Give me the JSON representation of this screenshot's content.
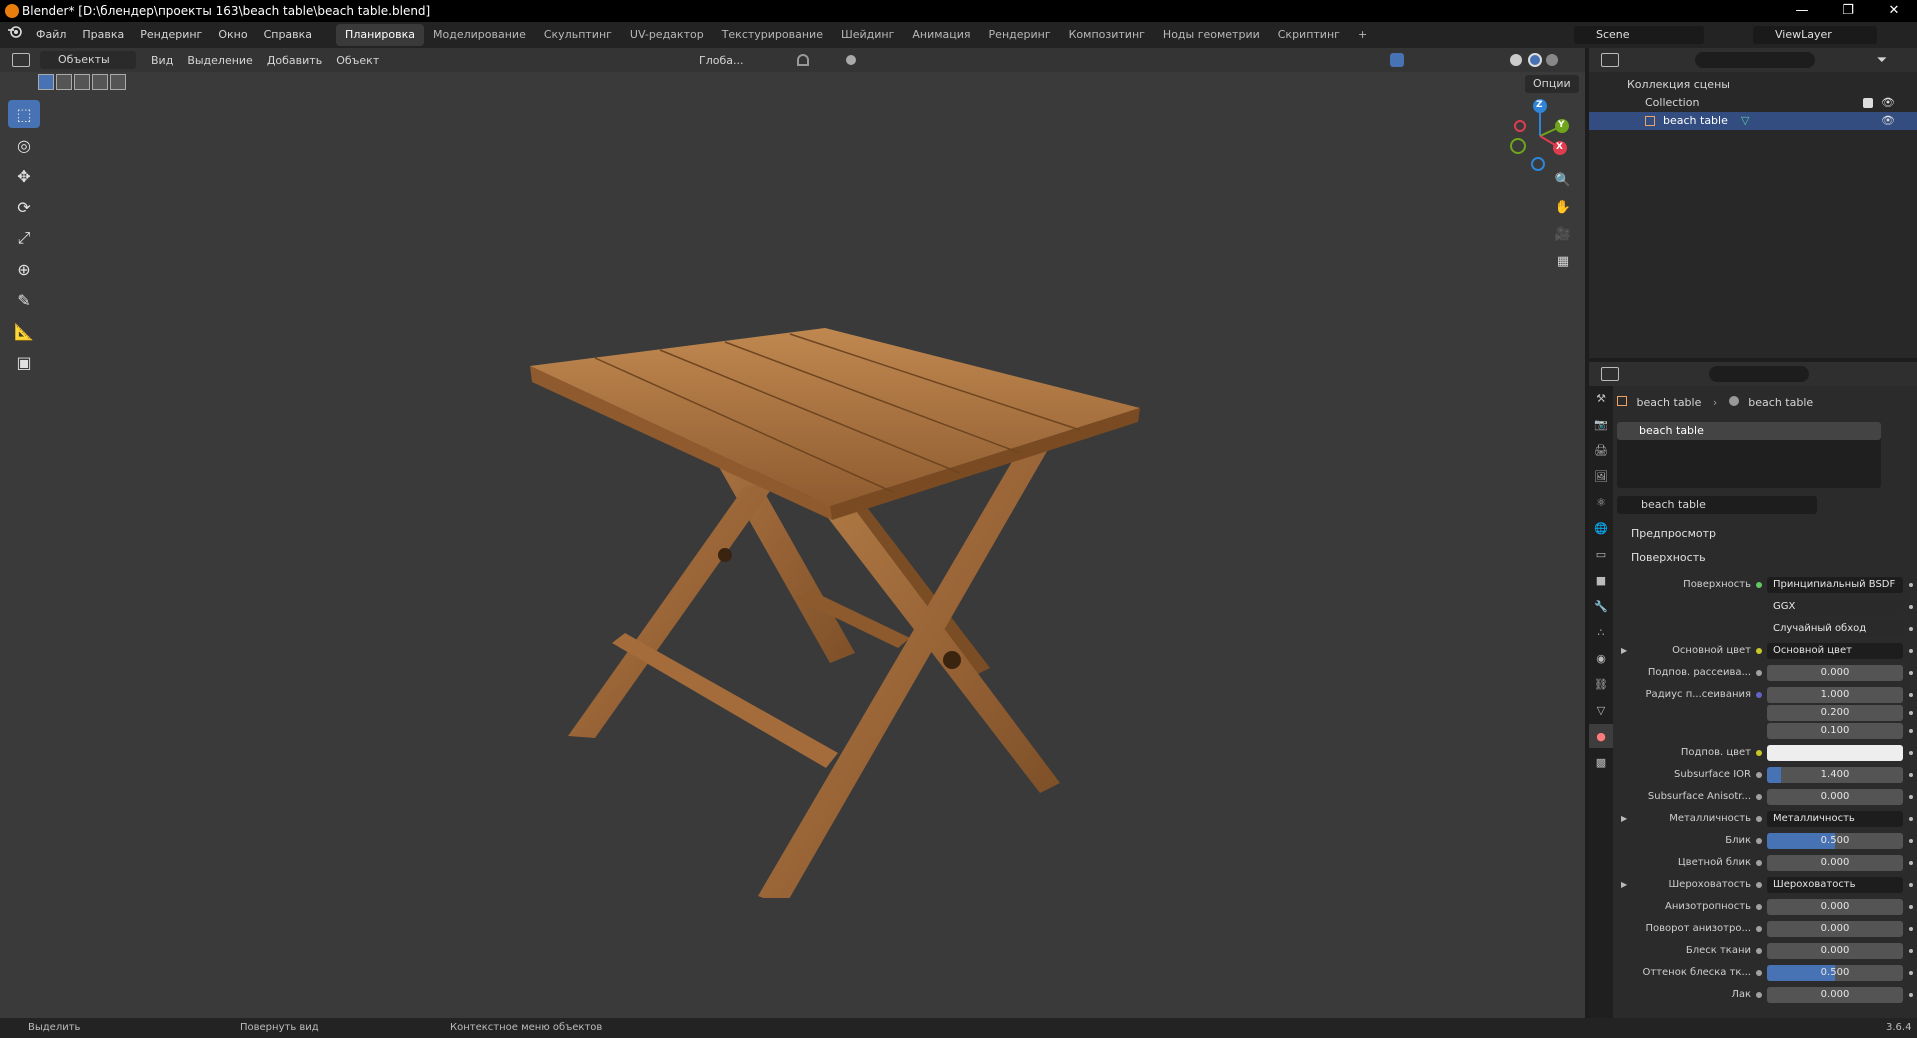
{
  "window": {
    "title": "Blender* [D:\\блендер\\проекты 163\\beach table\\beach table.blend]",
    "controls": [
      "—",
      "❐",
      "✕"
    ]
  },
  "menubar": {
    "items": [
      "Файл",
      "Правка",
      "Рендеринг",
      "Окно",
      "Справка"
    ],
    "workspaces": [
      "Планировка",
      "Моделирование",
      "Скульптинг",
      "UV-редактор",
      "Текстурирование",
      "Шейдинг",
      "Анимация",
      "Рендеринг",
      "Композитинг",
      "Ноды геометрии",
      "Скриптинг"
    ],
    "active_workspace": "Планировка",
    "add_tab": "+",
    "scene": "Scene",
    "view_layer": "ViewLayer"
  },
  "viewport": {
    "mode": "Объекты",
    "menus": [
      "Вид",
      "Выделение",
      "Добавить",
      "Объект"
    ],
    "orientation": "Глоба...",
    "options_label": "Опции",
    "gizmo_labels": {
      "z": "Z",
      "y": "Y",
      "x": "X"
    },
    "tools": [
      "select-box",
      "cursor",
      "move",
      "rotate",
      "scale",
      "transform",
      "annotate",
      "measure",
      "add-cube"
    ]
  },
  "outliner": {
    "root": "Коллекция сцены",
    "collection": "Collection",
    "object": "beach table"
  },
  "properties": {
    "breadcrumb_object": "beach table",
    "breadcrumb_material": "beach table",
    "slot_name": "beach table",
    "material_name": "beach table",
    "sections": {
      "preview": "Предпросмотр",
      "surface": "Поверхность"
    },
    "rows": [
      {
        "label": "Поверхность",
        "value": "Принципиальный BSDF",
        "kind": "dark",
        "dot": "green"
      },
      {
        "label": "",
        "value": "GGX",
        "kind": "select"
      },
      {
        "label": "",
        "value": "Случайный обход",
        "kind": "select"
      },
      {
        "label": "Основной цвет",
        "value": "Основной цвет",
        "kind": "dark",
        "dot": "yellow",
        "expand": true
      },
      {
        "label": "Подпов. рассеива...",
        "value": "0.000",
        "kind": "num",
        "dot": "gray"
      },
      {
        "label": "Радиус п...сеивания",
        "value": "1.000",
        "kind": "num",
        "dot": "blue"
      },
      {
        "label": "",
        "value": "0.200",
        "kind": "num"
      },
      {
        "label": "",
        "value": "0.100",
        "kind": "num"
      },
      {
        "label": "Подпов. цвет",
        "value": "",
        "kind": "white",
        "dot": "yellow"
      },
      {
        "label": "Subsurface IOR",
        "value": "1.400",
        "kind": "num",
        "dot": "gray",
        "fill": 0.1
      },
      {
        "label": "Subsurface Anisotr...",
        "value": "0.000",
        "kind": "num",
        "dot": "gray"
      },
      {
        "label": "Металличность",
        "value": "Металличность",
        "kind": "dark",
        "dot": "gray",
        "expand": true
      },
      {
        "label": "Блик",
        "value": "0.500",
        "kind": "num",
        "dot": "gray",
        "fill": 0.5
      },
      {
        "label": "Цветной блик",
        "value": "0.000",
        "kind": "num",
        "dot": "gray"
      },
      {
        "label": "Шероховатость",
        "value": "Шероховатость",
        "kind": "dark",
        "dot": "gray",
        "expand": true
      },
      {
        "label": "Анизотропность",
        "value": "0.000",
        "kind": "num",
        "dot": "gray"
      },
      {
        "label": "Поворот анизотро...",
        "value": "0.000",
        "kind": "num",
        "dot": "gray"
      },
      {
        "label": "Блеск ткани",
        "value": "0.000",
        "kind": "num",
        "dot": "gray"
      },
      {
        "label": "Оттенок блеска тк...",
        "value": "0.500",
        "kind": "num",
        "dot": "gray",
        "fill": 0.5
      },
      {
        "label": "Лак",
        "value": "0.000",
        "kind": "num",
        "dot": "gray"
      }
    ]
  },
  "statusbar": {
    "select": "Выделить",
    "rotate": "Повернуть вид",
    "context": "Контекстное меню объектов",
    "version": "3.6.4"
  }
}
